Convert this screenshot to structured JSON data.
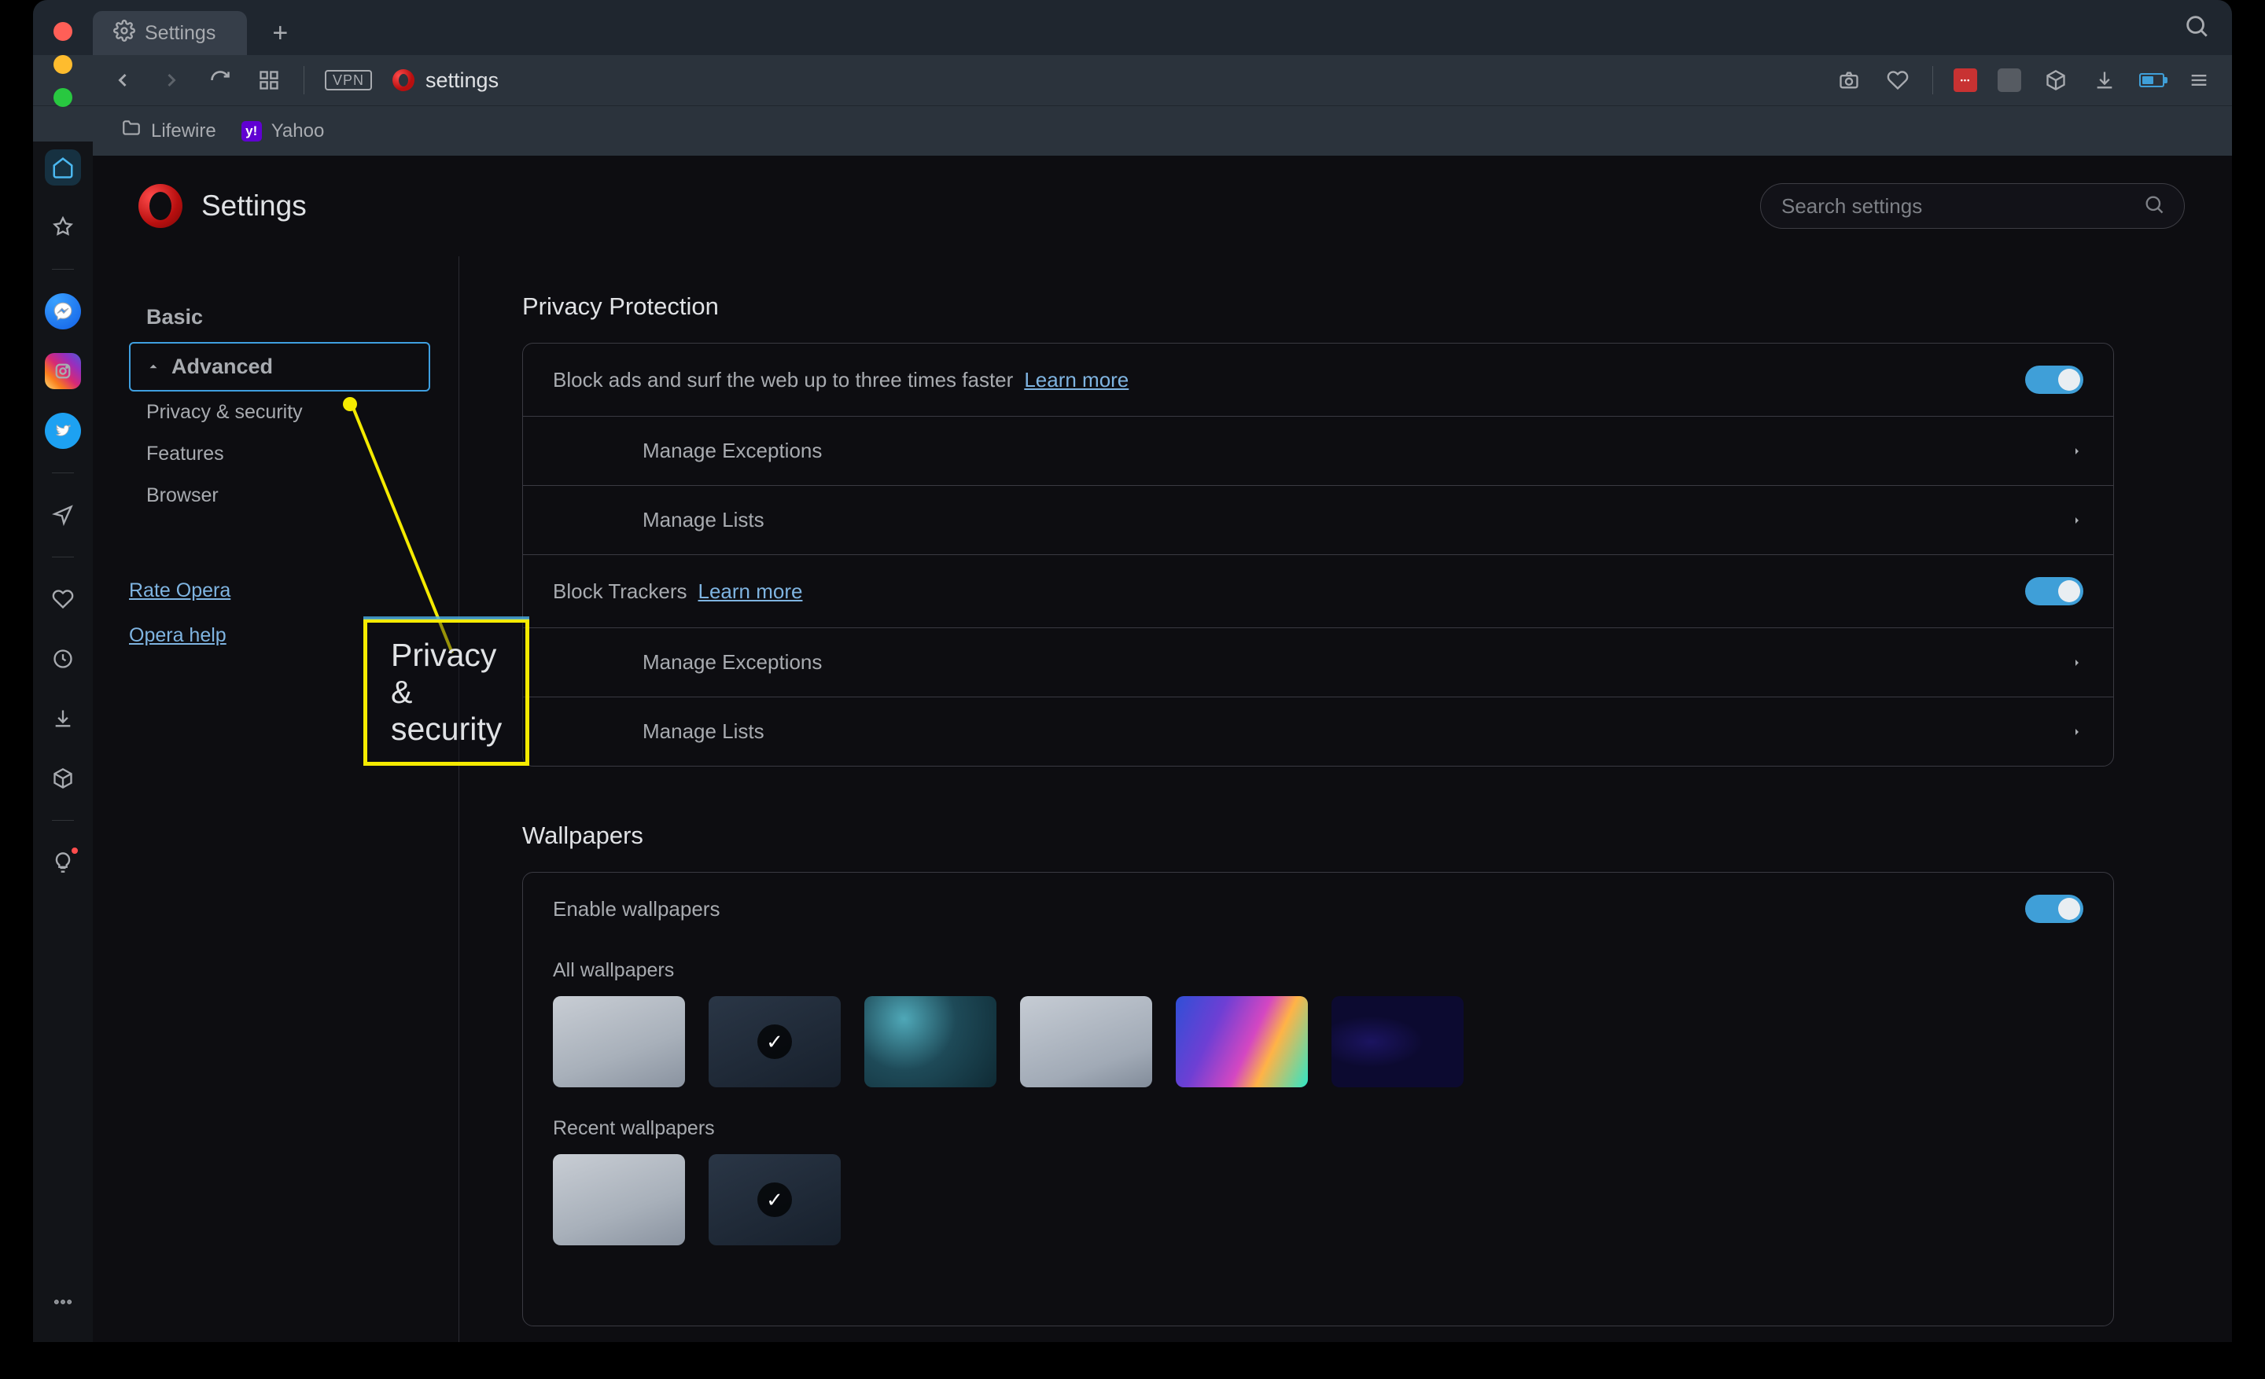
{
  "tab": {
    "title": "Settings"
  },
  "address": {
    "text": "settings"
  },
  "vpn": "VPN",
  "bookmarks": [
    {
      "label": "Lifewire",
      "icon": "folder"
    },
    {
      "label": "Yahoo",
      "icon": "yahoo"
    }
  ],
  "page": {
    "title": "Settings",
    "search_placeholder": "Search settings"
  },
  "nav": {
    "basic": "Basic",
    "advanced": "Advanced",
    "sub": {
      "privacy": "Privacy & security",
      "features": "Features",
      "browser": "Browser"
    },
    "links": {
      "rate": "Rate Opera",
      "help": "Opera help"
    }
  },
  "annotation": {
    "label": "Privacy & security"
  },
  "sections": {
    "privacy": {
      "title": "Privacy Protection",
      "block_ads": {
        "label": "Block ads and surf the web up to three times faster",
        "learn": "Learn more",
        "sub1": "Manage Exceptions",
        "sub2": "Manage Lists"
      },
      "block_trackers": {
        "label": "Block Trackers",
        "learn": "Learn more",
        "sub1": "Manage Exceptions",
        "sub2": "Manage Lists"
      }
    },
    "wallpapers": {
      "title": "Wallpapers",
      "enable": "Enable wallpapers",
      "all": "All wallpapers",
      "recent": "Recent wallpapers"
    }
  }
}
